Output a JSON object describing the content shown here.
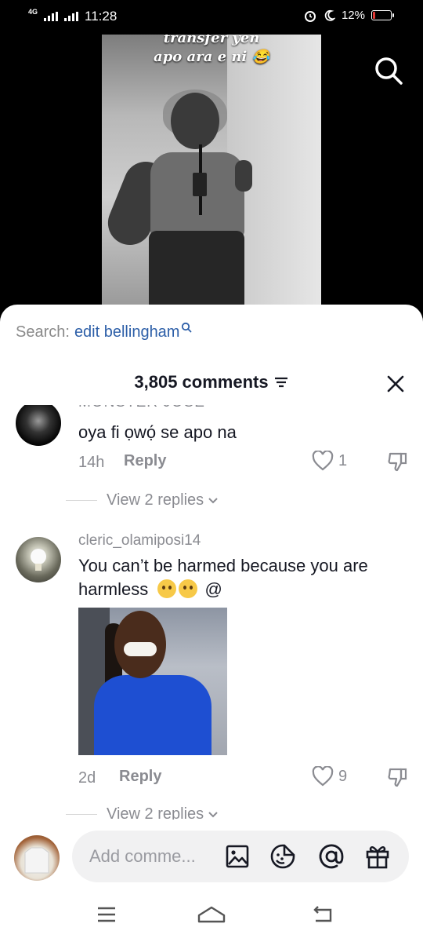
{
  "status_bar": {
    "network": "4G",
    "time": "11:28",
    "battery": "12%",
    "battery_level": 0.12
  },
  "video": {
    "caption_line1": "transfer yen",
    "caption_line2": "apo ara e ni 😂"
  },
  "search_bar": {
    "prefix": "Search:",
    "term": "edit bellingham"
  },
  "comments_header": {
    "count_label": "3,805 comments"
  },
  "comments": [
    {
      "username": "Monster Jose",
      "text": "oya fi ọwọ́ se apo na",
      "time": "14h",
      "reply_label": "Reply",
      "likes": "1",
      "view_replies": "View 2 replies"
    },
    {
      "username": "cleric_olamiposi14",
      "text": "You can’t be harmed because you are harmless",
      "text_suffix": "@",
      "time": "2d",
      "reply_label": "Reply",
      "likes": "9",
      "view_replies": "View 2 replies"
    }
  ],
  "input": {
    "placeholder": "Add comme..."
  },
  "icons": {
    "search": "search-icon",
    "close": "close-icon",
    "filter": "filter-icon",
    "like": "heart-icon",
    "dislike": "thumbs-down-icon",
    "image": "image-icon",
    "sticker": "sticker-icon",
    "mention": "at-icon",
    "gift": "gift-icon",
    "menu": "menu-icon",
    "home": "home-icon",
    "back": "back-icon"
  },
  "colors": {
    "search_term": "#2d5fa8",
    "text_primary": "#161823",
    "text_secondary": "#8a8b91"
  }
}
